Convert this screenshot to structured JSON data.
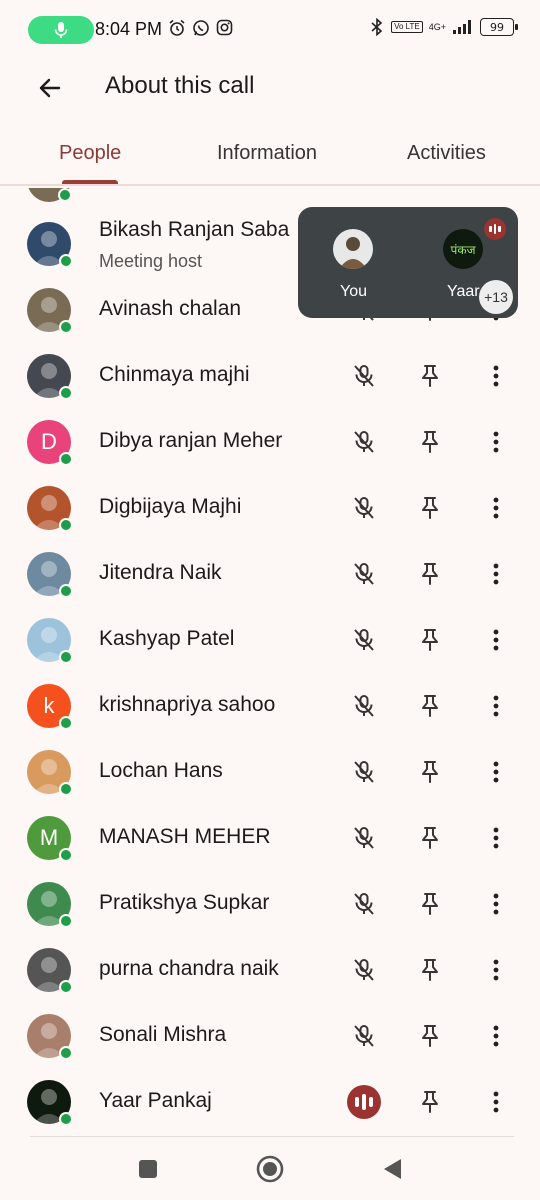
{
  "status_bar": {
    "time": "8:04 PM",
    "battery": "99",
    "volte_badge": "Vo LTE",
    "network": "4G+",
    "icons": [
      "alarm-icon",
      "whatsapp-icon",
      "instagram-icon",
      "bluetooth-icon",
      "signal-icon"
    ]
  },
  "app_bar": {
    "title": "About this call",
    "back_icon": "arrow-back-icon"
  },
  "tabs": [
    {
      "label": "People",
      "active": true
    },
    {
      "label": "Information",
      "active": false
    },
    {
      "label": "Activities",
      "active": false
    }
  ],
  "participants": [
    {
      "name": "Bikash Ranjan Saba",
      "subtitle": "Meeting host",
      "avatar_type": "photo",
      "avatar_color": "#2f4a6b",
      "state": "none"
    },
    {
      "name": "Avinash chalan",
      "subtitle": "",
      "avatar_type": "photo",
      "avatar_color": "#7a6b55",
      "state": "muted"
    },
    {
      "name": "Chinmaya majhi",
      "subtitle": "",
      "avatar_type": "photo",
      "avatar_color": "#444850",
      "state": "muted"
    },
    {
      "name": "Dibya ranjan Meher",
      "subtitle": "",
      "avatar_type": "letter",
      "letter": "D",
      "avatar_color": "#e8437b",
      "state": "muted"
    },
    {
      "name": "Digbijaya Majhi",
      "subtitle": "",
      "avatar_type": "photo",
      "avatar_color": "#b3542c",
      "state": "muted"
    },
    {
      "name": "Jitendra Naik",
      "subtitle": "",
      "avatar_type": "photo",
      "avatar_color": "#6e8aa0",
      "state": "muted"
    },
    {
      "name": "Kashyap Patel",
      "subtitle": "",
      "avatar_type": "photo",
      "avatar_color": "#9dc3dc",
      "state": "muted"
    },
    {
      "name": "krishnapriya sahoo",
      "subtitle": "",
      "avatar_type": "letter",
      "letter": "k",
      "avatar_color": "#f4511e",
      "state": "muted"
    },
    {
      "name": "Lochan Hans",
      "subtitle": "",
      "avatar_type": "photo",
      "avatar_color": "#d99a5e",
      "state": "muted"
    },
    {
      "name": "MANASH MEHER",
      "subtitle": "",
      "avatar_type": "letter",
      "letter": "M",
      "avatar_color": "#4f9a3d",
      "state": "muted"
    },
    {
      "name": "Pratikshya Supkar",
      "subtitle": "",
      "avatar_type": "photo",
      "avatar_color": "#3e8a4f",
      "state": "muted"
    },
    {
      "name": "purna chandra naik",
      "subtitle": "",
      "avatar_type": "photo",
      "avatar_color": "#555555",
      "state": "muted"
    },
    {
      "name": "Sonali Mishra",
      "subtitle": "",
      "avatar_type": "photo",
      "avatar_color": "#a87f6a",
      "state": "muted"
    },
    {
      "name": "Yaar Pankaj",
      "subtitle": "",
      "avatar_type": "photo",
      "avatar_color": "#0d1a0d",
      "state": "speaking"
    }
  ],
  "overlay": {
    "tiles": [
      {
        "label": "You",
        "avatar_color": "#5a4a3a"
      },
      {
        "label": "Yaar",
        "avatar_color": "#0d1a0d"
      }
    ],
    "more_count": "+13"
  },
  "nav": {
    "recent": "square-icon",
    "home": "circle-icon",
    "back": "triangle-back-icon"
  },
  "colors": {
    "accent": "#8c3b36",
    "online": "#1e9e4a",
    "speaking": "#9b3430",
    "overlay_bg": "#3e4446"
  }
}
